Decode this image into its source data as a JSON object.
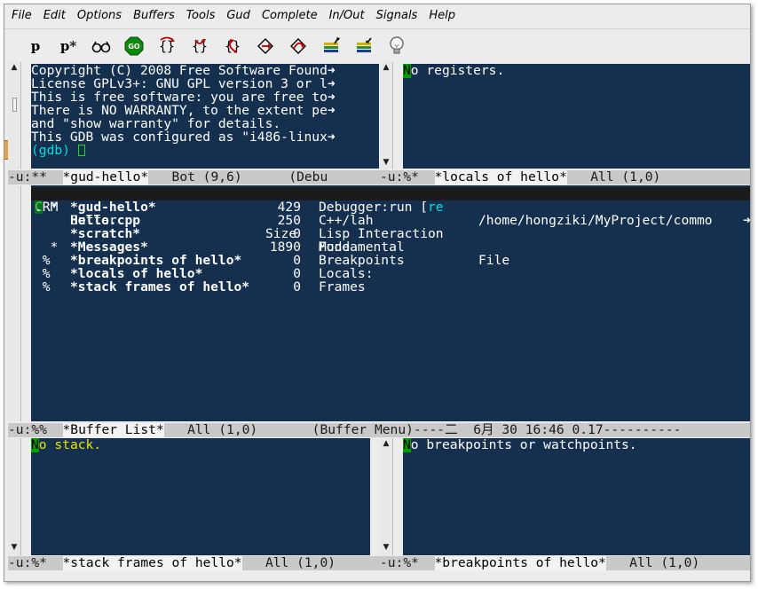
{
  "menu": [
    "File",
    "Edit",
    "Options",
    "Buffers",
    "Tools",
    "Gud",
    "Complete",
    "In/Out",
    "Signals",
    "Help"
  ],
  "toolbar": {
    "p_label": "p",
    "pstar_label": "p*",
    "go_label": "GO"
  },
  "gdb_window": {
    "lines": [
      "Copyright (C) 2008 Free Software Found",
      "License GPLv3+: GNU GPL version 3 or l",
      "This is free software: you are free to",
      "There is NO WARRANTY, to the extent pe",
      "and \"show warranty\" for details.",
      "This GDB was configured as \"i486-linux"
    ],
    "prompt": "(gdb)",
    "modeline_left": "-u:**  ",
    "modeline_buf": "*gud-hello*",
    "modeline_right": "   Bot (9,6)      (Debu"
  },
  "registers_window": {
    "first_char": "N",
    "text": "o registers.",
    "modeline_left": "-u:%*  ",
    "modeline_buf": "*locals of hello*",
    "modeline_right": "   All (1,0)"
  },
  "buffer_list": {
    "headers": {
      "crm": "CRM",
      "buffer": "Buffer",
      "size": "Size",
      "mode": "Mode",
      "file": "File"
    },
    "rows": [
      {
        "crm": ". *",
        "buffer": "*gud-hello*",
        "size": "429",
        "mode": "Debugger:run [re",
        "file": ""
      },
      {
        "crm": "",
        "buffer": "Hello.cpp",
        "size": "250",
        "mode": "C++/lah",
        "file": "/home/hongziki/MyProject/commo"
      },
      {
        "crm": "",
        "buffer": "*scratch*",
        "size": "0",
        "mode": "Lisp Interaction",
        "file": ""
      },
      {
        "crm": "  *",
        "buffer": "*Messages*",
        "size": "1890",
        "mode": "Fundamental",
        "file": ""
      },
      {
        "crm": " %",
        "buffer": "*breakpoints of hello*",
        "size": "0",
        "mode": "Breakpoints",
        "file": ""
      },
      {
        "crm": " %",
        "buffer": "*locals of hello*",
        "size": "0",
        "mode": "Locals:",
        "file": ""
      },
      {
        "crm": " %",
        "buffer": "*stack frames of hello*",
        "size": "0",
        "mode": "Frames",
        "file": ""
      }
    ],
    "modeline_left": "-u:%%  ",
    "modeline_buf": "*Buffer List*",
    "modeline_right": "   All (1,0)       (Buffer Menu)----二  6月 30 16:46 0.17----------"
  },
  "stack_window": {
    "first_char": "N",
    "text": "o stack.",
    "modeline_left": "-u:%*  ",
    "modeline_buf": "*stack frames of hello*",
    "modeline_right": "   All (1,0)"
  },
  "breakpoints_window": {
    "first_char": "N",
    "text": "o breakpoints or watchpoints.",
    "modeline_left": "-u:%*  ",
    "modeline_buf": "*breakpoints of hello*",
    "modeline_right": "   All (1,0)"
  },
  "colors": {
    "window_bg": "#14304e",
    "modeline_bg": "#c9c9c9",
    "cursor": "#00a000",
    "prompt": "#00e0e0",
    "message": "#e6e600"
  }
}
